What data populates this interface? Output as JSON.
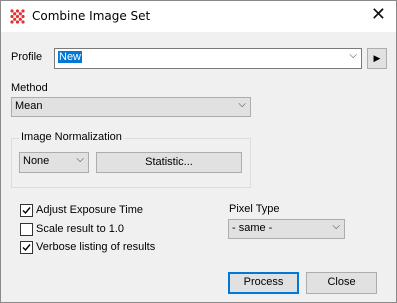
{
  "window": {
    "title": "Combine Image Set",
    "close_glyph": "✕",
    "app_icon": "grid-icon"
  },
  "profile": {
    "label": "Profile",
    "value": "New",
    "arrow_btn_glyph": "▶"
  },
  "method": {
    "label": "Method",
    "value": "Mean"
  },
  "normalization": {
    "group_label": "Image Normalization",
    "value": "None",
    "statistic_label": "Statistic..."
  },
  "options": [
    {
      "label": "Adjust Exposure Time",
      "checked": true
    },
    {
      "label": "Scale result to 1.0",
      "checked": false
    },
    {
      "label": "Verbose listing of results",
      "checked": true
    }
  ],
  "pixel_type": {
    "label": "Pixel Type",
    "value": "- same -"
  },
  "buttons": {
    "process": "Process",
    "close": "Close"
  },
  "colors": {
    "accent": "#0078d7",
    "icon_red": "#e03030"
  }
}
